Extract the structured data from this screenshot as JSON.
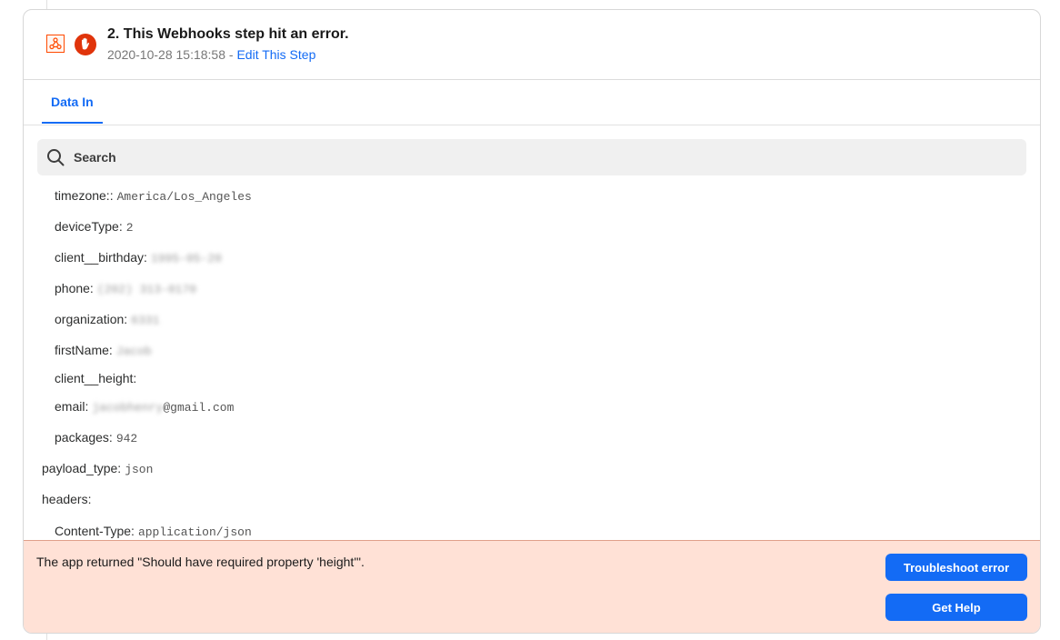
{
  "step": {
    "title": "2. This Webhooks step hit an error.",
    "date": "2020-10-28 15:18:58",
    "separator": " - ",
    "edit_link": "Edit This Step"
  },
  "tabs": [
    {
      "label": "Data In"
    }
  ],
  "search": {
    "placeholder": "Search"
  },
  "fields": [
    {
      "key": "timezone::",
      "value": "America/Los_Angeles",
      "blurred": false
    },
    {
      "key": "deviceType:",
      "value": "2",
      "blurred": false
    },
    {
      "key": "client__birthday:",
      "value": "1995-05-20",
      "blurred": true
    },
    {
      "key": "phone:",
      "value": "(202) 313-0170",
      "blurred": true
    },
    {
      "key": "organization:",
      "value": "6331",
      "blurred": true
    },
    {
      "key": "firstName:",
      "value": "Jacob",
      "blurred": true
    },
    {
      "key": "client__height:",
      "value": "",
      "blurred": false
    },
    {
      "key": "email:",
      "value_blurred": "jacobhenry",
      "value": "@gmail.com",
      "blurred": false
    },
    {
      "key": "packages:",
      "value": "942",
      "blurred": false
    },
    {
      "key": "payload_type:",
      "value": "json",
      "blurred": false
    },
    {
      "key": "headers:",
      "value": "",
      "blurred": false
    },
    {
      "key": "Content-Type:",
      "value": "application/json",
      "blurred": false
    }
  ],
  "error": {
    "message": "The app returned \"Should have required property 'height'\".",
    "troubleshoot_label": "Troubleshoot error",
    "help_label": "Get Help"
  },
  "colors": {
    "accent": "#136bf5",
    "error_background": "#ffe1d6",
    "error_icon": "#e0340b",
    "app_brand": "#ff4a00"
  },
  "icons": {
    "app": "webhooks-icon",
    "status": "stop-hand-icon",
    "search": "search-icon"
  }
}
